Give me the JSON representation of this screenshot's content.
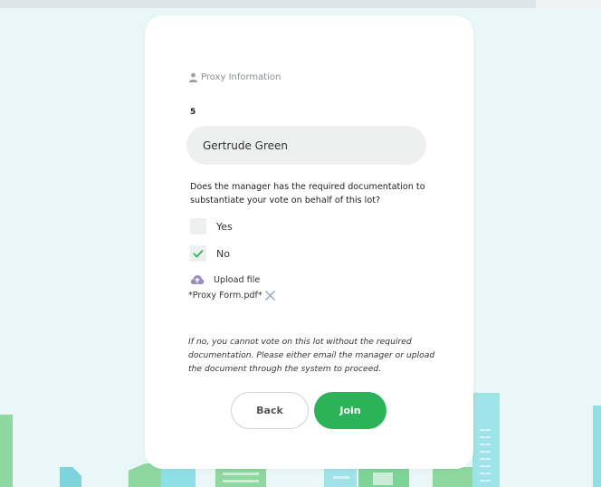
{
  "section": {
    "title": "Proxy Information",
    "icon": "user-icon"
  },
  "lot_number": "5",
  "proxy_name": {
    "value": "Gertrude Green"
  },
  "question": "Does the manager has the required documentation to substantiate your vote on behalf of this lot?",
  "options": [
    {
      "label": "Yes",
      "checked": false
    },
    {
      "label": "No",
      "checked": true
    }
  ],
  "upload": {
    "label": "Upload file",
    "icon": "cloud-upload-icon"
  },
  "file": {
    "name": "*Proxy Form.pdf*",
    "remove_icon": "close-icon"
  },
  "note": "If no, you cannot vote on this lot without the required documentation. Please either email the manager or upload the document through the system to proceed.",
  "buttons": {
    "back": "Back",
    "join": "Join"
  },
  "colors": {
    "accent": "#2cb35a",
    "background": "#eaf7f8",
    "card": "#ffffff",
    "upload_icon": "#9a8fbe",
    "close_icon": "#9ba2c8"
  }
}
